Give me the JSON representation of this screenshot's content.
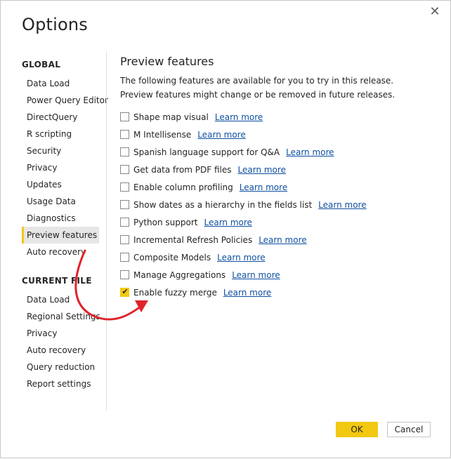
{
  "dialog": {
    "title": "Options",
    "close_glyph": "✕"
  },
  "sidebar": {
    "global_header": "GLOBAL",
    "global_items": [
      {
        "label": "Data Load"
      },
      {
        "label": "Power Query Editor"
      },
      {
        "label": "DirectQuery"
      },
      {
        "label": "R scripting"
      },
      {
        "label": "Security"
      },
      {
        "label": "Privacy"
      },
      {
        "label": "Updates"
      },
      {
        "label": "Usage Data"
      },
      {
        "label": "Diagnostics"
      },
      {
        "label": "Preview features"
      },
      {
        "label": "Auto recovery"
      }
    ],
    "current_file_header": "CURRENT FILE",
    "current_file_items": [
      {
        "label": "Data Load"
      },
      {
        "label": "Regional Settings"
      },
      {
        "label": "Privacy"
      },
      {
        "label": "Auto recovery"
      },
      {
        "label": "Query reduction"
      },
      {
        "label": "Report settings"
      }
    ]
  },
  "content": {
    "title": "Preview features",
    "description": "The following features are available for you to try in this release. Preview features might change or be removed in future releases.",
    "features": [
      {
        "label": "Shape map visual",
        "link": "Learn more",
        "checked": false
      },
      {
        "label": "M Intellisense",
        "link": "Learn more",
        "checked": false
      },
      {
        "label": "Spanish language support for Q&A",
        "link": "Learn more",
        "checked": false
      },
      {
        "label": "Get data from PDF files",
        "link": "Learn more",
        "checked": false
      },
      {
        "label": "Enable column profiling",
        "link": "Learn more",
        "checked": false
      },
      {
        "label": "Show dates as a hierarchy in the fields list",
        "link": "Learn more",
        "checked": false
      },
      {
        "label": "Python support",
        "link": "Learn more",
        "checked": false
      },
      {
        "label": "Incremental Refresh Policies",
        "link": "Learn more",
        "checked": false
      },
      {
        "label": "Composite Models",
        "link": "Learn more",
        "checked": false
      },
      {
        "label": "Manage Aggregations",
        "link": "Learn more",
        "checked": false
      },
      {
        "label": "Enable fuzzy merge",
        "link": "Learn more",
        "checked": true
      }
    ],
    "check_glyph": "✔"
  },
  "buttons": {
    "ok": "OK",
    "cancel": "Cancel"
  },
  "colors": {
    "accent": "#f2c811",
    "link": "#0e4fa0",
    "annotation_arrow": "#e0232b"
  }
}
